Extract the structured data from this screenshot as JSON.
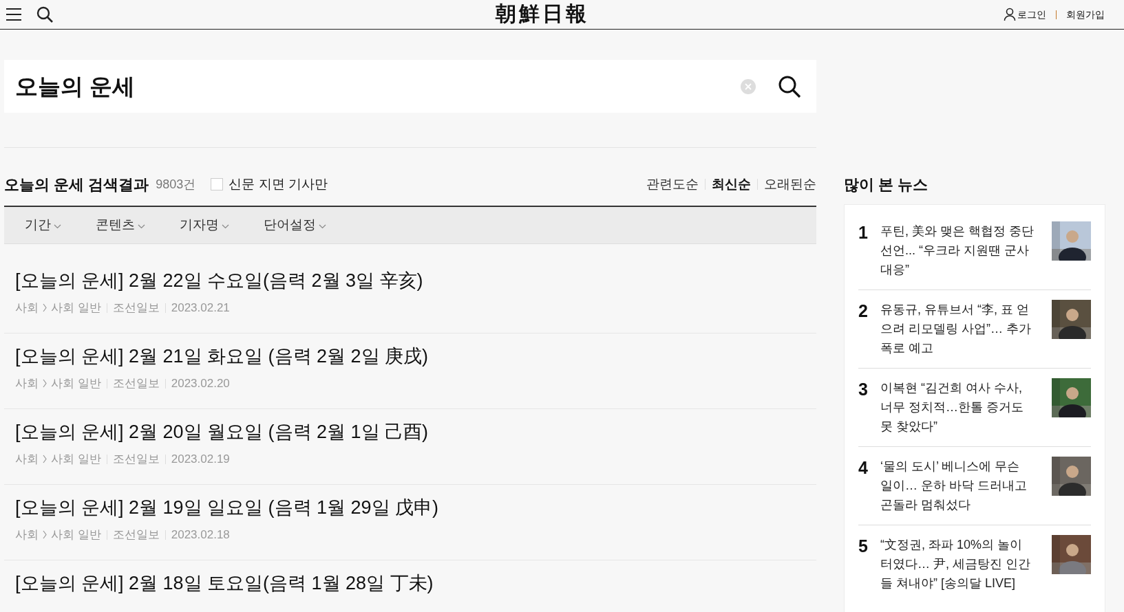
{
  "header": {
    "logo": "朝鮮日報",
    "login": "로그인",
    "signup": "회원가입"
  },
  "search": {
    "value": "오늘의 운세"
  },
  "results_header": {
    "query": "오늘의 운세",
    "label": "검색결과",
    "count": "9803건",
    "print_only": {
      "label": "신문 지면 기사만",
      "checked": false
    },
    "sort": [
      {
        "label": "관련도순",
        "selected": false
      },
      {
        "label": "최신순",
        "selected": true
      },
      {
        "label": "오래된순",
        "selected": false
      }
    ]
  },
  "filters": [
    "기간",
    "콘텐츠",
    "기자명",
    "단어설정"
  ],
  "results": [
    {
      "title": "[오늘의 운세] 2월 22일 수요일(음력 2월 3일 辛亥)",
      "section": "사회",
      "subsection": "사회 일반",
      "source": "조선일보",
      "date": "2023.02.21"
    },
    {
      "title": "[오늘의 운세] 2월 21일 화요일 (음력 2월 2일 庚戌)",
      "section": "사회",
      "subsection": "사회 일반",
      "source": "조선일보",
      "date": "2023.02.20"
    },
    {
      "title": "[오늘의 운세] 2월 20일 월요일 (음력 2월 1일 己酉)",
      "section": "사회",
      "subsection": "사회 일반",
      "source": "조선일보",
      "date": "2023.02.19"
    },
    {
      "title": "[오늘의 운세] 2월 19일 일요일 (음력 1월 29일 戊申)",
      "section": "사회",
      "subsection": "사회 일반",
      "source": "조선일보",
      "date": "2023.02.18"
    },
    {
      "title": "[오늘의 운세] 2월 18일 토요일(음력 1월 28일 丁未)"
    }
  ],
  "most_viewed": {
    "title": "많이 본 뉴스",
    "items": [
      {
        "rank": "1",
        "title": "푸틴, 美와 맺은 핵협정 중단 선언... “우크라 지원땐 군사대응”"
      },
      {
        "rank": "2",
        "title": "유동규, 유튜브서 “李, 표 얻으려 리모델링 사업”… 추가 폭로 예고"
      },
      {
        "rank": "3",
        "title": "이복현 “김건희 여사 수사, 너무 정치적…한톨 증거도 못 찾았다”"
      },
      {
        "rank": "4",
        "title": "‘물의 도시’ 베니스에 무슨 일이… 운하 바닥 드러내고 곤돌라 멈춰섰다"
      },
      {
        "rank": "5",
        "title": "“文정권, 좌파 10%의 놀이터였다… 尹, 세금탕진 인간들 쳐내야” [송의달 LIVE]"
      }
    ]
  }
}
